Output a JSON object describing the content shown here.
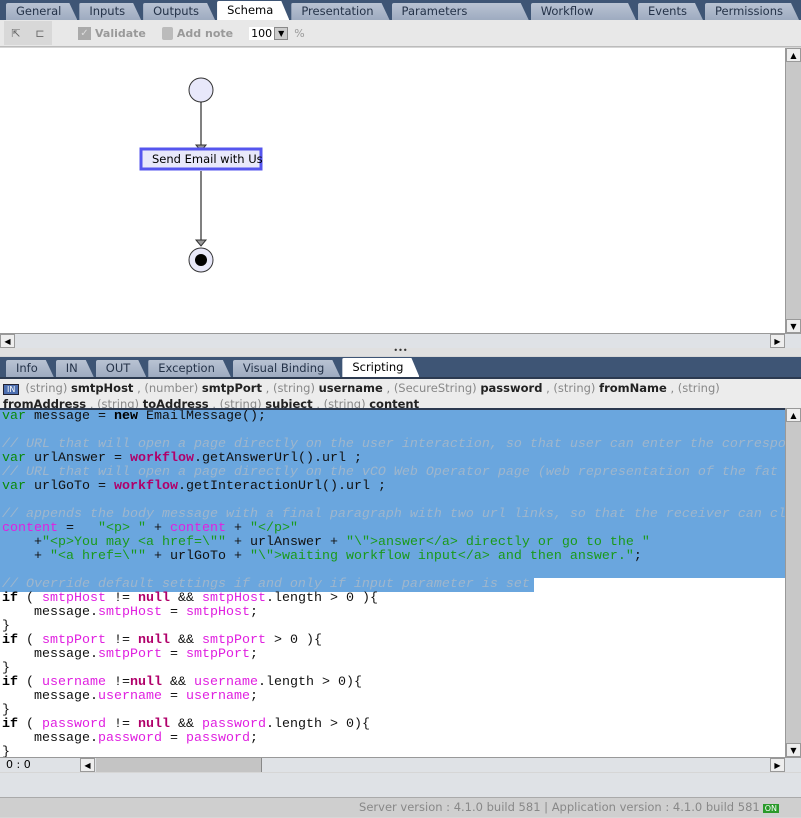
{
  "top_tabs": [
    "General",
    "Inputs",
    "Outputs",
    "Schema",
    "Presentation",
    "Parameters References",
    "Workflow Tokens",
    "Events",
    "Permissions"
  ],
  "top_active": "Schema",
  "toolbar": {
    "validate": "Validate",
    "add_note": "Add note",
    "zoom": "100",
    "zoom_unit": "%"
  },
  "schema": {
    "task_label": "Send Email with Us"
  },
  "bottom_tabs": [
    "Info",
    "IN",
    "OUT",
    "Exception",
    "Visual Binding",
    "Scripting"
  ],
  "bottom_active": "Scripting",
  "in_badge": "IN",
  "params": [
    [
      "(string)",
      "smtpHost"
    ],
    [
      "(number)",
      "smtpPort"
    ],
    [
      "(string)",
      "username"
    ],
    [
      "(SecureString)",
      "password"
    ],
    [
      "(string)",
      "fromName"
    ],
    [
      "(string)",
      "fromAddress"
    ],
    [
      "(string)",
      "toAddress"
    ],
    [
      "(string)",
      "subject"
    ],
    [
      "(string)",
      "content"
    ]
  ],
  "code": [
    [
      [
        "kw",
        "var"
      ],
      [
        "tx",
        " message = "
      ],
      [
        "kb",
        "new"
      ],
      [
        "tx",
        " EmailMessage();"
      ]
    ],
    [],
    [
      [
        "cm",
        "// URL that will open a page directly on the user interaction, so that user can enter the correspo"
      ]
    ],
    [
      [
        "kw",
        "var"
      ],
      [
        "tx",
        " urlAnswer = "
      ],
      [
        "glob",
        "workflow"
      ],
      [
        "tx",
        ".getAnswerUrl().url ;"
      ]
    ],
    [
      [
        "cm",
        "// URL that will open a page directly on the vCO Web Operator page (web representation of the fat "
      ]
    ],
    [
      [
        "kw",
        "var"
      ],
      [
        "tx",
        " urlGoTo = "
      ],
      [
        "glob",
        "workflow"
      ],
      [
        "tx",
        ".getInteractionUrl().url ;"
      ]
    ],
    [],
    [
      [
        "cm",
        "// appends the body message with a final paragraph with two url links, so that the receiver can cl"
      ]
    ],
    [
      [
        "var",
        "content"
      ],
      [
        "tx",
        " =   "
      ],
      [
        "str",
        "\"<p> \""
      ],
      [
        "tx",
        " + "
      ],
      [
        "var",
        "content"
      ],
      [
        "tx",
        " + "
      ],
      [
        "str",
        "\"</p>\""
      ]
    ],
    [
      [
        "tx",
        "    +"
      ],
      [
        "str",
        "\"<p>You may <a href=\\\"\""
      ],
      [
        "tx",
        " + urlAnswer + "
      ],
      [
        "str",
        "\"\\\">answer</a> directly or go to the \""
      ]
    ],
    [
      [
        "tx",
        "    + "
      ],
      [
        "str",
        "\"<a href=\\\"\""
      ],
      [
        "tx",
        " + urlGoTo + "
      ],
      [
        "str",
        "\"\\\">waiting workflow input</a> and then answer.\""
      ],
      [
        "tx",
        ";"
      ]
    ],
    [],
    [
      [
        "cm",
        "// Override default settings if and only if input parameter is set"
      ]
    ],
    [
      [
        "kb",
        "if"
      ],
      [
        "tx",
        " ( "
      ],
      [
        "var",
        "smtpHost"
      ],
      [
        "tx",
        " != "
      ],
      [
        "glob",
        "null"
      ],
      [
        "tx",
        " && "
      ],
      [
        "var",
        "smtpHost"
      ],
      [
        "tx",
        ".length > 0 ){"
      ]
    ],
    [
      [
        "tx",
        "    message."
      ],
      [
        "var",
        "smtpHost"
      ],
      [
        "tx",
        " = "
      ],
      [
        "var",
        "smtpHost"
      ],
      [
        "tx",
        ";"
      ]
    ],
    [
      [
        "tx",
        "}"
      ]
    ],
    [
      [
        "kb",
        "if"
      ],
      [
        "tx",
        " ( "
      ],
      [
        "var",
        "smtpPort"
      ],
      [
        "tx",
        " != "
      ],
      [
        "glob",
        "null"
      ],
      [
        "tx",
        " && "
      ],
      [
        "var",
        "smtpPort"
      ],
      [
        "tx",
        " > 0 ){"
      ]
    ],
    [
      [
        "tx",
        "    message."
      ],
      [
        "var",
        "smtpPort"
      ],
      [
        "tx",
        " = "
      ],
      [
        "var",
        "smtpPort"
      ],
      [
        "tx",
        ";"
      ]
    ],
    [
      [
        "tx",
        "}"
      ]
    ],
    [
      [
        "kb",
        "if"
      ],
      [
        "tx",
        " ( "
      ],
      [
        "var",
        "username"
      ],
      [
        "tx",
        " !="
      ],
      [
        "glob",
        "null"
      ],
      [
        "tx",
        " && "
      ],
      [
        "var",
        "username"
      ],
      [
        "tx",
        ".length > 0){"
      ]
    ],
    [
      [
        "tx",
        "    message."
      ],
      [
        "var",
        "username"
      ],
      [
        "tx",
        " = "
      ],
      [
        "var",
        "username"
      ],
      [
        "tx",
        ";"
      ]
    ],
    [
      [
        "tx",
        "}"
      ]
    ],
    [
      [
        "kb",
        "if"
      ],
      [
        "tx",
        " ( "
      ],
      [
        "var",
        "password"
      ],
      [
        "tx",
        " != "
      ],
      [
        "glob",
        "null"
      ],
      [
        "tx",
        " && "
      ],
      [
        "var",
        "password"
      ],
      [
        "tx",
        ".length > 0){"
      ]
    ],
    [
      [
        "tx",
        "    message."
      ],
      [
        "var",
        "password"
      ],
      [
        "tx",
        " = "
      ],
      [
        "var",
        "password"
      ],
      [
        "tx",
        ";"
      ]
    ],
    [
      [
        "tx",
        "}"
      ]
    ]
  ],
  "cursor_position": "0 : 0",
  "status": {
    "text": "Server version : 4.1.0 build 581 | Application version : 4.1.0 build 581",
    "badge": "ON"
  }
}
